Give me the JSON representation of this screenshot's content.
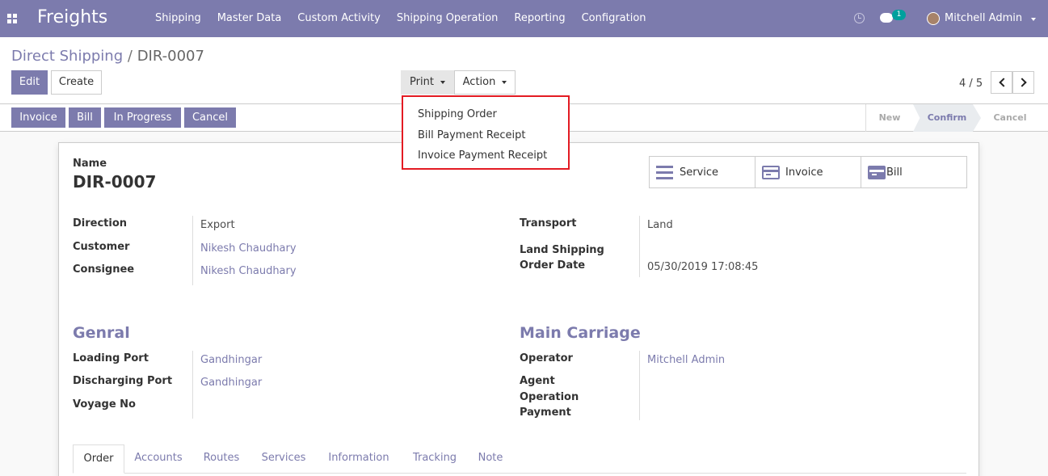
{
  "navbar": {
    "app_title": "Freights",
    "menu": [
      "Shipping",
      "Master Data",
      "Custom Activity",
      "Shipping Operation",
      "Reporting",
      "Configration"
    ],
    "chat_count": "1",
    "user_name": "Mitchell Admin",
    "colors": {
      "primary": "#7c7bad",
      "badge": "#00a09d"
    }
  },
  "control": {
    "breadcrumb_parent": "Direct Shipping",
    "breadcrumb_sep": "/",
    "breadcrumb_current": "DIR-0007",
    "edit_label": "Edit",
    "create_label": "Create",
    "print_label": "Print",
    "action_label": "Action",
    "pager": "4 / 5"
  },
  "print_menu": [
    "Shipping Order",
    "Bill Payment Receipt",
    "Invoice Payment Receipt"
  ],
  "statusbar": {
    "buttons": [
      "Invoice",
      "Bill",
      "In Progress",
      "Cancel"
    ],
    "stages": [
      "New",
      "Confirm",
      "Cancel"
    ],
    "active_stage": "Confirm"
  },
  "form": {
    "name_label": "Name",
    "name_value": "DIR-0007",
    "smart_buttons": [
      "Service",
      "Invoice",
      "Bill"
    ],
    "direction_label": "Direction",
    "direction_value": "Export",
    "customer_label": "Customer",
    "customer_value": "Nikesh Chaudhary",
    "consignee_label": "Consignee",
    "consignee_value": "Nikesh Chaudhary",
    "transport_label": "Transport",
    "transport_value": "Land",
    "order_date_label_1": "Land Shipping",
    "order_date_label_2": "Order Date",
    "order_date_value": "05/30/2019 17:08:45",
    "general_title": "Genral",
    "loading_port_label": "Loading Port",
    "loading_port_value": "Gandhingar",
    "discharging_port_label": "Discharging Port",
    "discharging_port_value": "Gandhingar",
    "voyage_label": "Voyage No",
    "main_carriage_title": "Main Carriage",
    "operator_label": "Operator",
    "operator_value": "Mitchell Admin",
    "agent_label": "Agent",
    "operation_payment_label_1": "Operation",
    "operation_payment_label_2": "Payment",
    "tabs": [
      "Order",
      "Accounts",
      "Routes",
      "Services",
      "Information",
      "Tracking",
      "Note"
    ]
  }
}
